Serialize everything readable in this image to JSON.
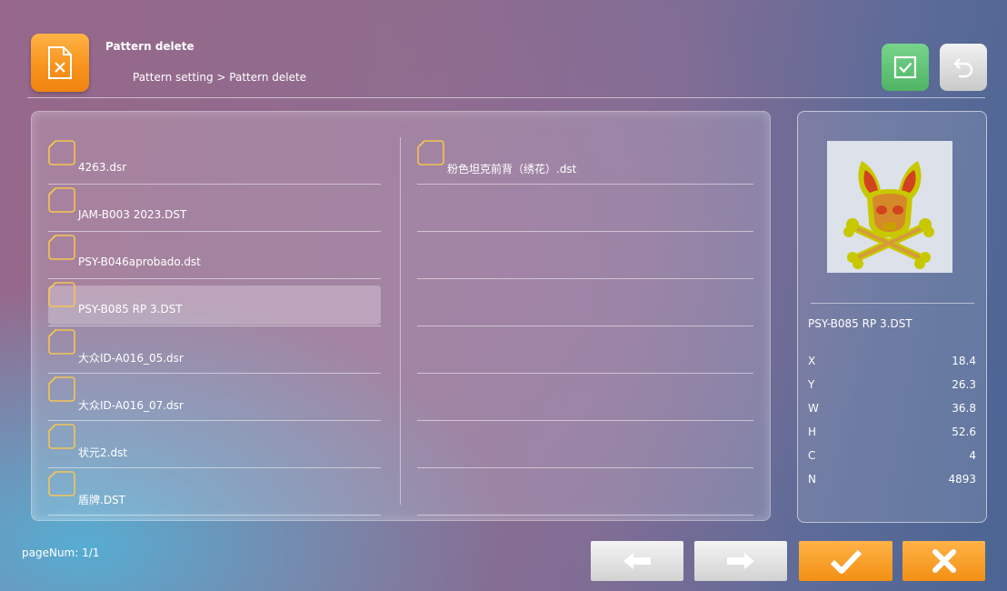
{
  "header": {
    "title": "Pattern delete",
    "breadcrumb": "Pattern setting > Pattern delete",
    "icon": "delete-file-icon",
    "confirm_icon": "checkbox-check-icon",
    "back_icon": "undo-arrow-icon"
  },
  "files": {
    "left": [
      {
        "name": "4263.dsr"
      },
      {
        "name": "JAM-B003 2023.DST"
      },
      {
        "name": "PSY-B046aprobado.dst"
      },
      {
        "name": "PSY-B085 RP 3.DST",
        "selected": true
      },
      {
        "name": "大众ID-A016_05.dsr"
      },
      {
        "name": "大众ID-A016_07.dsr"
      },
      {
        "name": "状元2.dst"
      },
      {
        "name": "盾牌.DST"
      }
    ],
    "right": [
      {
        "name": "粉色坦克前背（绣花）.dst"
      },
      {
        "name": ""
      },
      {
        "name": ""
      },
      {
        "name": ""
      },
      {
        "name": ""
      },
      {
        "name": ""
      },
      {
        "name": ""
      },
      {
        "name": ""
      }
    ]
  },
  "preview": {
    "filename": "PSY-B085 RP 3.DST",
    "stats": [
      {
        "label": "X",
        "value": "18.4"
      },
      {
        "label": "Y",
        "value": "26.3"
      },
      {
        "label": "W",
        "value": "36.8"
      },
      {
        "label": "H",
        "value": "52.6"
      },
      {
        "label": "C",
        "value": "4"
      },
      {
        "label": "N",
        "value": "4893"
      }
    ]
  },
  "footer": {
    "page_num": "pageNum: 1/1",
    "prev_icon": "arrow-left-icon",
    "next_icon": "arrow-right-icon",
    "ok_icon": "check-icon",
    "cancel_icon": "close-icon"
  },
  "colors": {
    "accent_orange": "#f7941d",
    "confirm_green": "#5cbf73",
    "selection": "#ffffff44"
  }
}
